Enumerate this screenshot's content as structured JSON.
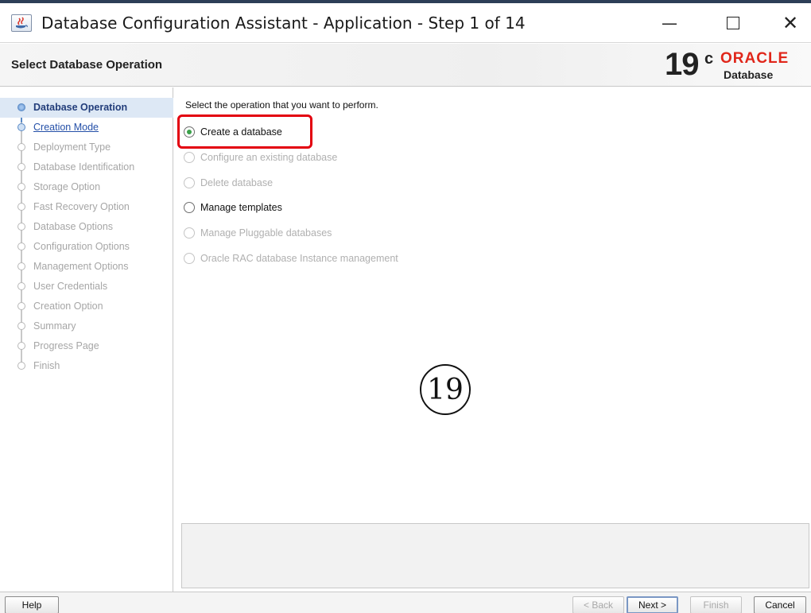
{
  "window": {
    "title": "Database Configuration Assistant - Application - Step 1 of 14",
    "controls": {
      "minimize": "—",
      "close": "✕"
    }
  },
  "header": {
    "title": "Select Database Operation",
    "logo": {
      "version": "19",
      "superscript": "c",
      "brand": "ORACLE",
      "product": "Database",
      "brand_color": "#e0261a"
    }
  },
  "sidebar": {
    "steps": [
      {
        "label": "Database Operation",
        "state": "active"
      },
      {
        "label": "Creation Mode",
        "state": "next"
      },
      {
        "label": "Deployment Type",
        "state": "disabled"
      },
      {
        "label": "Database Identification",
        "state": "disabled"
      },
      {
        "label": "Storage Option",
        "state": "disabled"
      },
      {
        "label": "Fast Recovery Option",
        "state": "disabled"
      },
      {
        "label": "Database Options",
        "state": "disabled"
      },
      {
        "label": "Configuration Options",
        "state": "disabled"
      },
      {
        "label": "Management Options",
        "state": "disabled"
      },
      {
        "label": "User Credentials",
        "state": "disabled"
      },
      {
        "label": "Creation Option",
        "state": "disabled"
      },
      {
        "label": "Summary",
        "state": "disabled"
      },
      {
        "label": "Progress Page",
        "state": "disabled"
      },
      {
        "label": "Finish",
        "state": "disabled"
      }
    ]
  },
  "main": {
    "instruction": "Select the operation that you want to perform.",
    "options": [
      {
        "label": "Create a database",
        "selected": true,
        "enabled": true
      },
      {
        "label": "Configure an existing database",
        "selected": false,
        "enabled": false
      },
      {
        "label": "Delete database",
        "selected": false,
        "enabled": false
      },
      {
        "label": "Manage templates",
        "selected": false,
        "enabled": true
      },
      {
        "label": "Manage Pluggable databases",
        "selected": false,
        "enabled": false
      },
      {
        "label": "Oracle RAC database Instance management",
        "selected": false,
        "enabled": false
      }
    ],
    "annotation": "19"
  },
  "footer": {
    "help": "Help",
    "back": "< Back",
    "next": "Next >",
    "finish": "Finish",
    "cancel": "Cancel"
  },
  "colors": {
    "highlight": "#e3000f",
    "selected_radio": "#3aa14a",
    "active_step": "#223d7a"
  }
}
